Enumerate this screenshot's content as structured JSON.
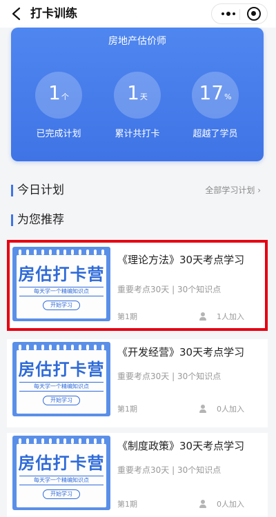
{
  "header": {
    "title": "打卡训练",
    "back_icon": "chevron-left-icon",
    "more_icon": "more-dots-icon",
    "target_icon": "target-icon"
  },
  "stats_card": {
    "title": "房地产估价师",
    "background_color": "#4a7eea",
    "stats": [
      {
        "value": "1",
        "unit": "个",
        "label": "已完成计划"
      },
      {
        "value": "1",
        "unit": "天",
        "label": "累计共打卡"
      },
      {
        "value": "17",
        "unit": "%",
        "label": "超越了学员"
      }
    ]
  },
  "today_plan": {
    "title": "今日计划",
    "all_plans_label": "全部学习计划 ›"
  },
  "recommend": {
    "title": "为您推荐"
  },
  "thumbnail": {
    "headline": "房估打卡营",
    "tagline": "每天学一个精编知识点",
    "button": "开始学习"
  },
  "courses": [
    {
      "name": "《理论方法》30天考点学习",
      "desc": "重要考点30天 | 30个知识点",
      "period": "第1期",
      "joined": "1人加入",
      "highlighted": true
    },
    {
      "name": "《开发经营》30天考点学习",
      "desc": "重要考点30天 | 30个知识点",
      "period": "第1期",
      "joined": "0人加入",
      "highlighted": false
    },
    {
      "name": "《制度政策》30天考点学习",
      "desc": "重要考点30天 | 30个知识点",
      "period": "第1期",
      "joined": "0人加入",
      "highlighted": false
    }
  ],
  "colors": {
    "accent": "#3f74e6",
    "highlight_border": "#e60012"
  }
}
